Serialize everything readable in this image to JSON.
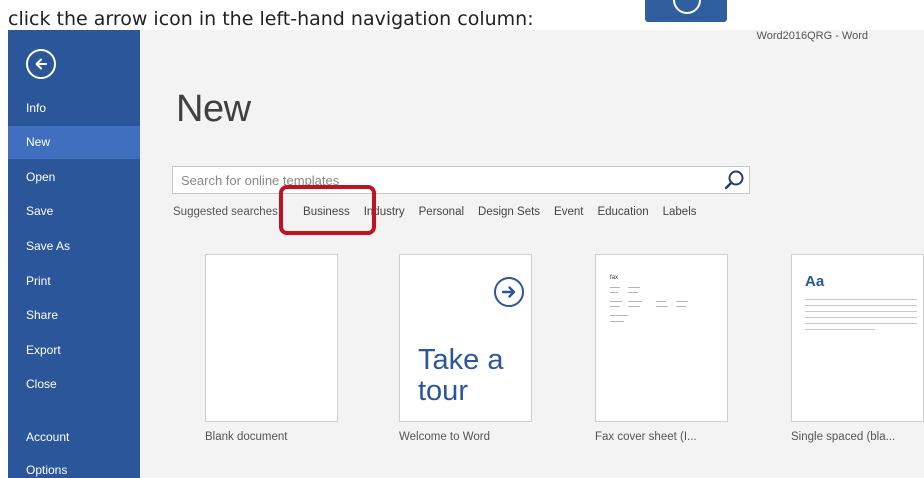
{
  "instruction": {
    "text": "click the arrow icon in the left-hand navigation column:"
  },
  "window": {
    "title": "Word2016QRG - Word"
  },
  "nav": {
    "items": [
      {
        "label": "Info"
      },
      {
        "label": "New",
        "active": true
      },
      {
        "label": "Open"
      },
      {
        "label": "Save"
      },
      {
        "label": "Save As"
      },
      {
        "label": "Print"
      },
      {
        "label": "Share"
      },
      {
        "label": "Export"
      },
      {
        "label": "Close"
      },
      {
        "label": "Account"
      },
      {
        "label": "Options"
      }
    ]
  },
  "main": {
    "title": "New",
    "search": {
      "placeholder": "Search for online templates",
      "value": ""
    },
    "suggested": {
      "label": "Suggested searches:",
      "links": [
        "Business",
        "Industry",
        "Personal",
        "Design Sets",
        "Event",
        "Education",
        "Labels"
      ]
    },
    "templates": [
      {
        "label": "Blank document"
      },
      {
        "label": "Welcome to Word",
        "tour_text": "Take a\ntour"
      },
      {
        "label": "Fax cover sheet (I...",
        "thumb_title": "fax"
      },
      {
        "label": "Single spaced (bla...",
        "thumb_heading": "Aa"
      }
    ]
  },
  "colors": {
    "nav_bg": "#2b579a",
    "nav_active": "#3f6fbe",
    "highlight": "#c1121f",
    "canvas": "#f3f3f3"
  },
  "icons": {
    "back": "back-arrow-icon",
    "search": "search-icon",
    "tour": "right-arrow-icon"
  }
}
